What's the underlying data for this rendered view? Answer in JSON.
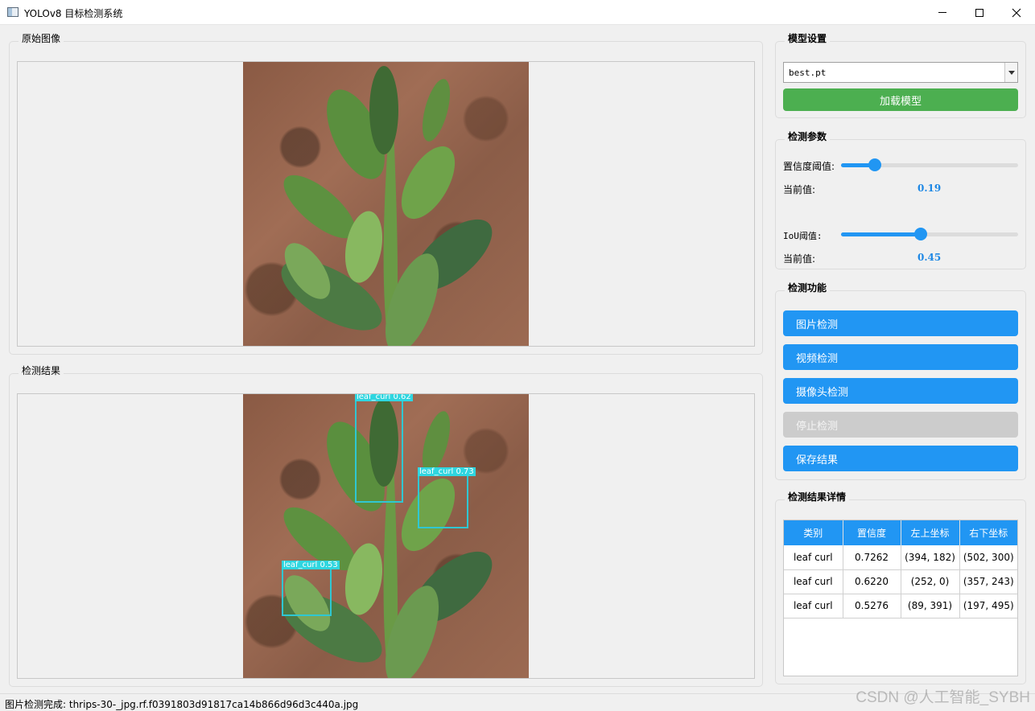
{
  "window": {
    "title": "YOLOv8 目标检测系统"
  },
  "original": {
    "title": "原始图像"
  },
  "result": {
    "title": "检测结果",
    "detections": [
      {
        "label": "leaf_curl 0.62"
      },
      {
        "label": "leaf_curl 0.73"
      },
      {
        "label": "leaf_curl 0.53"
      }
    ]
  },
  "model": {
    "title": "模型设置",
    "selected": "best.pt",
    "load_label": "加载模型"
  },
  "params": {
    "title": "检测参数",
    "conf_label": "置信度阈值:",
    "conf_current_label": "当前值:",
    "conf_value": "0.19",
    "conf_level": 0.19,
    "iou_label": "IoU阈值:",
    "iou_current_label": "当前值:",
    "iou_value": "0.45",
    "iou_level": 0.45
  },
  "functions": {
    "title": "检测功能",
    "image_detect": "图片检测",
    "video_detect": "视频检测",
    "camera_detect": "摄像头检测",
    "stop_detect": "停止检测",
    "save_result": "保存结果"
  },
  "details": {
    "title": "检测结果详情",
    "headers": [
      "类别",
      "置信度",
      "左上坐标",
      "右下坐标"
    ],
    "rows": [
      [
        "leaf curl",
        "0.7262",
        "(394, 182)",
        "(502, 300)"
      ],
      [
        "leaf curl",
        "0.6220",
        "(252, 0)",
        "(357, 243)"
      ],
      [
        "leaf curl",
        "0.5276",
        "(89, 391)",
        "(197, 495)"
      ]
    ]
  },
  "status": {
    "text": "图片检测完成: thrips-30-_jpg.rf.f0391803d91817ca14b866d96d3c440a.jpg"
  },
  "watermark": "CSDN @人工智能_SYBH",
  "colors": {
    "accent": "#2196f3",
    "load": "#4caf50",
    "disabled": "#cccccc",
    "box": "#2fc7d2"
  }
}
